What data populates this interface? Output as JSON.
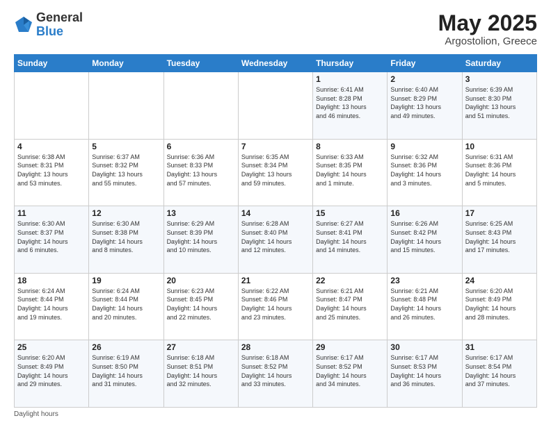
{
  "header": {
    "logo_general": "General",
    "logo_blue": "Blue",
    "month_year": "May 2025",
    "location": "Argostolion, Greece"
  },
  "weekdays": [
    "Sunday",
    "Monday",
    "Tuesday",
    "Wednesday",
    "Thursday",
    "Friday",
    "Saturday"
  ],
  "weeks": [
    [
      {
        "day": "",
        "info": ""
      },
      {
        "day": "",
        "info": ""
      },
      {
        "day": "",
        "info": ""
      },
      {
        "day": "",
        "info": ""
      },
      {
        "day": "1",
        "info": "Sunrise: 6:41 AM\nSunset: 8:28 PM\nDaylight: 13 hours\nand 46 minutes."
      },
      {
        "day": "2",
        "info": "Sunrise: 6:40 AM\nSunset: 8:29 PM\nDaylight: 13 hours\nand 49 minutes."
      },
      {
        "day": "3",
        "info": "Sunrise: 6:39 AM\nSunset: 8:30 PM\nDaylight: 13 hours\nand 51 minutes."
      }
    ],
    [
      {
        "day": "4",
        "info": "Sunrise: 6:38 AM\nSunset: 8:31 PM\nDaylight: 13 hours\nand 53 minutes."
      },
      {
        "day": "5",
        "info": "Sunrise: 6:37 AM\nSunset: 8:32 PM\nDaylight: 13 hours\nand 55 minutes."
      },
      {
        "day": "6",
        "info": "Sunrise: 6:36 AM\nSunset: 8:33 PM\nDaylight: 13 hours\nand 57 minutes."
      },
      {
        "day": "7",
        "info": "Sunrise: 6:35 AM\nSunset: 8:34 PM\nDaylight: 13 hours\nand 59 minutes."
      },
      {
        "day": "8",
        "info": "Sunrise: 6:33 AM\nSunset: 8:35 PM\nDaylight: 14 hours\nand 1 minute."
      },
      {
        "day": "9",
        "info": "Sunrise: 6:32 AM\nSunset: 8:36 PM\nDaylight: 14 hours\nand 3 minutes."
      },
      {
        "day": "10",
        "info": "Sunrise: 6:31 AM\nSunset: 8:36 PM\nDaylight: 14 hours\nand 5 minutes."
      }
    ],
    [
      {
        "day": "11",
        "info": "Sunrise: 6:30 AM\nSunset: 8:37 PM\nDaylight: 14 hours\nand 6 minutes."
      },
      {
        "day": "12",
        "info": "Sunrise: 6:30 AM\nSunset: 8:38 PM\nDaylight: 14 hours\nand 8 minutes."
      },
      {
        "day": "13",
        "info": "Sunrise: 6:29 AM\nSunset: 8:39 PM\nDaylight: 14 hours\nand 10 minutes."
      },
      {
        "day": "14",
        "info": "Sunrise: 6:28 AM\nSunset: 8:40 PM\nDaylight: 14 hours\nand 12 minutes."
      },
      {
        "day": "15",
        "info": "Sunrise: 6:27 AM\nSunset: 8:41 PM\nDaylight: 14 hours\nand 14 minutes."
      },
      {
        "day": "16",
        "info": "Sunrise: 6:26 AM\nSunset: 8:42 PM\nDaylight: 14 hours\nand 15 minutes."
      },
      {
        "day": "17",
        "info": "Sunrise: 6:25 AM\nSunset: 8:43 PM\nDaylight: 14 hours\nand 17 minutes."
      }
    ],
    [
      {
        "day": "18",
        "info": "Sunrise: 6:24 AM\nSunset: 8:44 PM\nDaylight: 14 hours\nand 19 minutes."
      },
      {
        "day": "19",
        "info": "Sunrise: 6:24 AM\nSunset: 8:44 PM\nDaylight: 14 hours\nand 20 minutes."
      },
      {
        "day": "20",
        "info": "Sunrise: 6:23 AM\nSunset: 8:45 PM\nDaylight: 14 hours\nand 22 minutes."
      },
      {
        "day": "21",
        "info": "Sunrise: 6:22 AM\nSunset: 8:46 PM\nDaylight: 14 hours\nand 23 minutes."
      },
      {
        "day": "22",
        "info": "Sunrise: 6:21 AM\nSunset: 8:47 PM\nDaylight: 14 hours\nand 25 minutes."
      },
      {
        "day": "23",
        "info": "Sunrise: 6:21 AM\nSunset: 8:48 PM\nDaylight: 14 hours\nand 26 minutes."
      },
      {
        "day": "24",
        "info": "Sunrise: 6:20 AM\nSunset: 8:49 PM\nDaylight: 14 hours\nand 28 minutes."
      }
    ],
    [
      {
        "day": "25",
        "info": "Sunrise: 6:20 AM\nSunset: 8:49 PM\nDaylight: 14 hours\nand 29 minutes."
      },
      {
        "day": "26",
        "info": "Sunrise: 6:19 AM\nSunset: 8:50 PM\nDaylight: 14 hours\nand 31 minutes."
      },
      {
        "day": "27",
        "info": "Sunrise: 6:18 AM\nSunset: 8:51 PM\nDaylight: 14 hours\nand 32 minutes."
      },
      {
        "day": "28",
        "info": "Sunrise: 6:18 AM\nSunset: 8:52 PM\nDaylight: 14 hours\nand 33 minutes."
      },
      {
        "day": "29",
        "info": "Sunrise: 6:17 AM\nSunset: 8:52 PM\nDaylight: 14 hours\nand 34 minutes."
      },
      {
        "day": "30",
        "info": "Sunrise: 6:17 AM\nSunset: 8:53 PM\nDaylight: 14 hours\nand 36 minutes."
      },
      {
        "day": "31",
        "info": "Sunrise: 6:17 AM\nSunset: 8:54 PM\nDaylight: 14 hours\nand 37 minutes."
      }
    ]
  ],
  "footer": {
    "note": "Daylight hours"
  }
}
